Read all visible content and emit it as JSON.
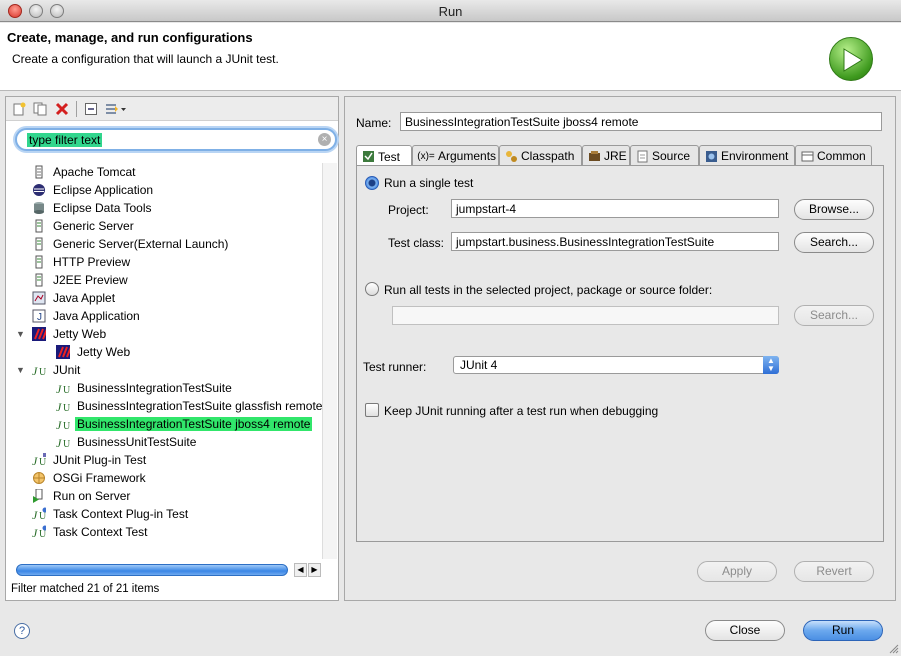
{
  "window": {
    "title": "Run"
  },
  "header": {
    "title": "Create, manage, and run configurations",
    "subtitle": "Create a configuration that will launch a JUnit test."
  },
  "filter": {
    "text": "type filter text",
    "status": "Filter matched 21 of 21 items"
  },
  "tree": [
    {
      "label": "Apache Tomcat",
      "icon": "document-icon"
    },
    {
      "label": "Eclipse Application",
      "icon": "eclipse-icon"
    },
    {
      "label": "Eclipse Data Tools",
      "icon": "database-icon"
    },
    {
      "label": "Generic Server",
      "icon": "server-icon"
    },
    {
      "label": "Generic Server(External Launch)",
      "icon": "server-icon"
    },
    {
      "label": "HTTP Preview",
      "icon": "server-icon"
    },
    {
      "label": "J2EE Preview",
      "icon": "server-icon"
    },
    {
      "label": "Java Applet",
      "icon": "applet-icon"
    },
    {
      "label": "Java Application",
      "icon": "java-icon"
    },
    {
      "label": "Jetty Web",
      "icon": "jetty-icon",
      "expanded": true
    },
    {
      "label": "Jetty Web",
      "icon": "jetty-icon",
      "child": true
    },
    {
      "label": "JUnit",
      "icon": "junit-icon",
      "expanded": true
    },
    {
      "label": "BusinessIntegrationTestSuite",
      "icon": "junit-icon",
      "child": true
    },
    {
      "label": "BusinessIntegrationTestSuite glassfish remote",
      "icon": "junit-icon",
      "child": true
    },
    {
      "label": "BusinessIntegrationTestSuite jboss4 remote",
      "icon": "junit-icon",
      "child": true,
      "selected": true
    },
    {
      "label": "BusinessUnitTestSuite",
      "icon": "junit-icon",
      "child": true
    },
    {
      "label": "JUnit Plug-in Test",
      "icon": "junit-plugin-icon"
    },
    {
      "label": "OSGi Framework",
      "icon": "osgi-icon"
    },
    {
      "label": "Run on Server",
      "icon": "run-server-icon"
    },
    {
      "label": "Task Context Plug-in Test",
      "icon": "task-context-icon"
    },
    {
      "label": "Task Context Test",
      "icon": "task-context-icon"
    }
  ],
  "config": {
    "name_label": "Name:",
    "name_value": "BusinessIntegrationTestSuite jboss4 remote",
    "tabs": [
      "Test",
      "Arguments",
      "Classpath",
      "JRE",
      "Source",
      "Environment",
      "Common"
    ],
    "run_single_label": "Run a single test",
    "project_label": "Project:",
    "project_value": "jumpstart-4",
    "browse_label": "Browse...",
    "test_class_label": "Test class:",
    "test_class_value": "jumpstart.business.BusinessIntegrationTestSuite",
    "search_label": "Search...",
    "run_all_label": "Run all tests in the selected project, package or source folder:",
    "run_all_value": "",
    "search2_label": "Search...",
    "test_runner_label": "Test runner:",
    "test_runner_value": "JUnit 4",
    "keep_running_label": "Keep JUnit running after a test run when debugging",
    "apply_label": "Apply",
    "revert_label": "Revert"
  },
  "footer": {
    "help": "?",
    "close_label": "Close",
    "run_label": "Run"
  }
}
